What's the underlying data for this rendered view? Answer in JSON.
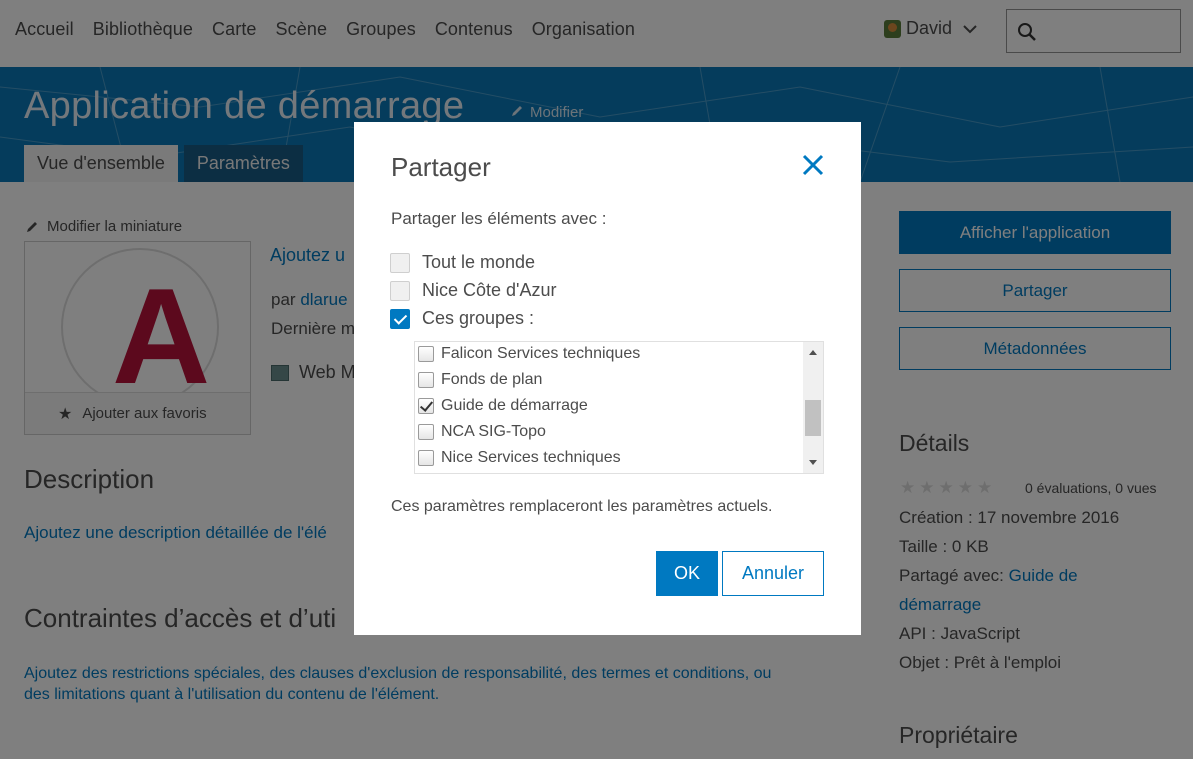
{
  "nav": {
    "items": [
      "Accueil",
      "Bibliothèque",
      "Carte",
      "Scène",
      "Groupes",
      "Contenus",
      "Organisation"
    ],
    "user_name": "David"
  },
  "banner": {
    "title": "Application de démarrage",
    "modify": "Modifier",
    "tabs": [
      "Vue d'ensemble",
      "Paramètres"
    ]
  },
  "left": {
    "thumb_edit": "Modifier la miniature",
    "thumb_letter": "A",
    "add_favorites": "Ajouter aux favoris",
    "summary_link": "Ajoutez u",
    "by_prefix": "par",
    "by_user": "dlarue",
    "last_modified": "Dernière m",
    "item_type": "Web M",
    "description_heading": "Description",
    "description_link": "Ajoutez une description détaillée de l'élé",
    "constraints_heading": "Contraintes d’accès et d’uti",
    "constraints_link": "Ajoutez des restrictions spéciales, des clauses d'exclusion de responsabilité, des termes et conditions, ou des limitations quant à l'utilisation du contenu de l'élément."
  },
  "right": {
    "view_app": "Afficher l'application",
    "share": "Partager",
    "metadata": "Métadonnées",
    "details_heading": "Détails",
    "evaluations": "0 évaluations, 0 vues",
    "created": "Création : 17 novembre 2016",
    "size": "Taille : 0 KB",
    "shared_with_label": "Partagé avec: ",
    "shared_with_group_1": "Guide de",
    "shared_with_group_2": "démarrage",
    "api": "API : JavaScript",
    "purpose": "Objet : Prêt à l'emploi",
    "owner_heading": "Propriétaire"
  },
  "modal": {
    "title": "Partager",
    "subtitle": "Partager les éléments avec :",
    "options": [
      {
        "label": "Tout le monde",
        "checked": false
      },
      {
        "label": "Nice Côte d'Azur",
        "checked": false
      },
      {
        "label": "Ces groupes :",
        "checked": true
      }
    ],
    "groups": [
      {
        "label": "Falicon Services techniques",
        "checked": false
      },
      {
        "label": "Fonds de plan",
        "checked": false
      },
      {
        "label": "Guide de démarrage",
        "checked": true
      },
      {
        "label": "NCA SIG-Topo",
        "checked": false
      },
      {
        "label": "Nice Services techniques",
        "checked": false
      }
    ],
    "note": "Ces paramètres remplaceront les paramètres actuels.",
    "ok": "OK",
    "cancel": "Annuler"
  },
  "colors": {
    "accent": "#0079c1",
    "banner": "#0b79b8",
    "thumb_letter": "#b8123a"
  }
}
